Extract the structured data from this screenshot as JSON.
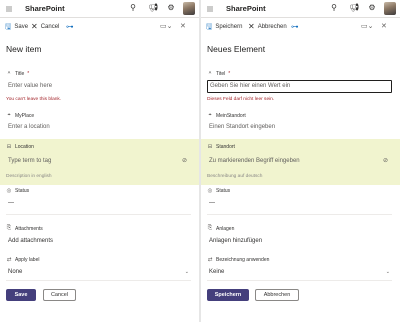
{
  "app": {
    "name": "SharePoint"
  },
  "colors": {
    "accent": "#443f7c",
    "highlight": "#f1f4cf",
    "error": "#a4262c",
    "icon": "#0f6cbd"
  },
  "icons": [
    "waffle-icon",
    "search-icon",
    "megaphone-icon",
    "settings-icon",
    "save-icon",
    "cancel-icon",
    "link-icon",
    "view-icon",
    "close-icon",
    "text-icon",
    "location-icon",
    "tag-icon",
    "status-icon",
    "attachment-icon",
    "apply-label-icon",
    "chevron-down-icon"
  ],
  "left": {
    "commands": {
      "save": "Save",
      "cancel": "Cancel"
    },
    "title": "New item",
    "fields": {
      "title": {
        "label": "Title",
        "placeholder": "Enter value here",
        "error": "You can't leave this blank."
      },
      "myplace": {
        "label": "MyPlace",
        "placeholder": "Enter a location"
      },
      "location": {
        "label": "Location",
        "placeholder": "Type term to tag",
        "description": "Description in english"
      },
      "status": {
        "label": "Status",
        "value": "—"
      },
      "attachments": {
        "label": "Attachments",
        "action": "Add attachments"
      },
      "apply_label": {
        "label": "Apply label",
        "value": "None"
      }
    },
    "buttons": {
      "save": "Save",
      "cancel": "Cancel"
    }
  },
  "right": {
    "commands": {
      "save": "Speichern",
      "cancel": "Abbrechen"
    },
    "title": "Neues Element",
    "fields": {
      "title": {
        "label": "Titel",
        "placeholder": "Geben Sie hier einen Wert ein",
        "error": "Dieses Feld darf nicht leer sein."
      },
      "myplace": {
        "label": "MeinStandort",
        "placeholder": "Einen Standort eingeben"
      },
      "location": {
        "label": "Standort",
        "placeholder": "Zu markierenden Begriff eingeben",
        "description": "Beschreibung auf deutsch"
      },
      "status": {
        "label": "Status",
        "value": "—"
      },
      "attachments": {
        "label": "Anlagen",
        "action": "Anlagen hinzufügen"
      },
      "apply_label": {
        "label": "Bezeichnung anwenden",
        "value": "Keine"
      }
    },
    "buttons": {
      "save": "Speichern",
      "cancel": "Abbrechen"
    }
  }
}
